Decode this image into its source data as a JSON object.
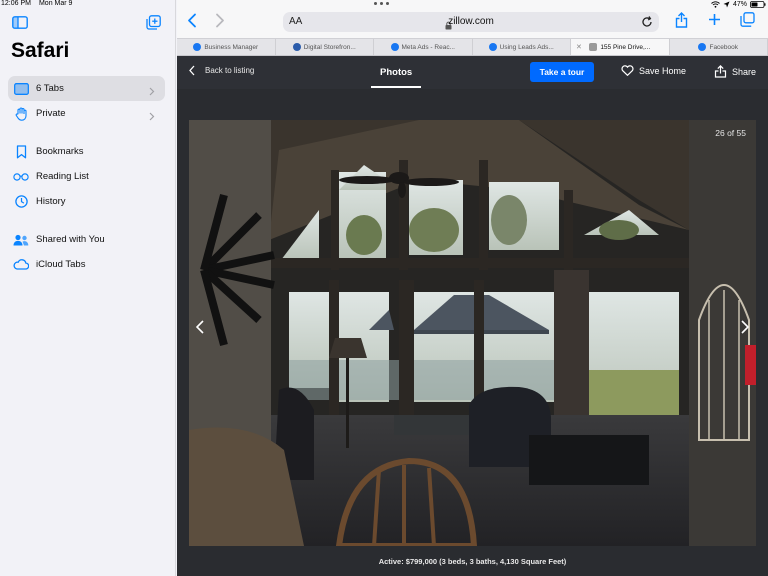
{
  "status": {
    "time": "12:06 PM",
    "date": "Mon Mar 9",
    "battery": "47%"
  },
  "sidebar": {
    "title": "Safari",
    "items": [
      {
        "label": "6 Tabs",
        "icon": "sidebar-tabs-icon",
        "active": true,
        "chevron": true
      },
      {
        "label": "Private",
        "icon": "hand-icon",
        "active": false,
        "chevron": true
      },
      {
        "label": "Bookmarks",
        "icon": "bookmark-icon"
      },
      {
        "label": "Reading List",
        "icon": "glasses-icon"
      },
      {
        "label": "History",
        "icon": "clock-icon"
      },
      {
        "label": "Shared with You",
        "icon": "shared-icon"
      },
      {
        "label": "iCloud Tabs",
        "icon": "cloud-icon"
      }
    ]
  },
  "address_bar": {
    "text_size_label": "AA",
    "url": "zillow.com"
  },
  "tabs": [
    {
      "label": "Business Manager",
      "favicon_color": "#1877f2"
    },
    {
      "label": "Digital Storefron...",
      "favicon_color": "#2b5cab"
    },
    {
      "label": "Meta Ads - Reac...",
      "favicon_color": "#1877f2"
    },
    {
      "label": "Using Leads Ads...",
      "favicon_color": "#1877f2"
    },
    {
      "label": "155 Pine Drive,...",
      "favicon_color": "#9a9a9a",
      "active": true
    },
    {
      "label": "Facebook",
      "favicon_color": "#1877f2"
    }
  ],
  "listing": {
    "back_label": "Back to listing",
    "tab_label": "Photos",
    "tour_button": "Take a tour",
    "save_label": "Save Home",
    "share_label": "Share",
    "photo_counter": "26 of 55",
    "caption": "Active: $799,000 (3 beds, 3 baths, 4,130 Square Feet)"
  },
  "colors": {
    "accent": "#006aff",
    "ios_blue": "#0a84ff",
    "viewer_bg": "#2a2c30"
  }
}
